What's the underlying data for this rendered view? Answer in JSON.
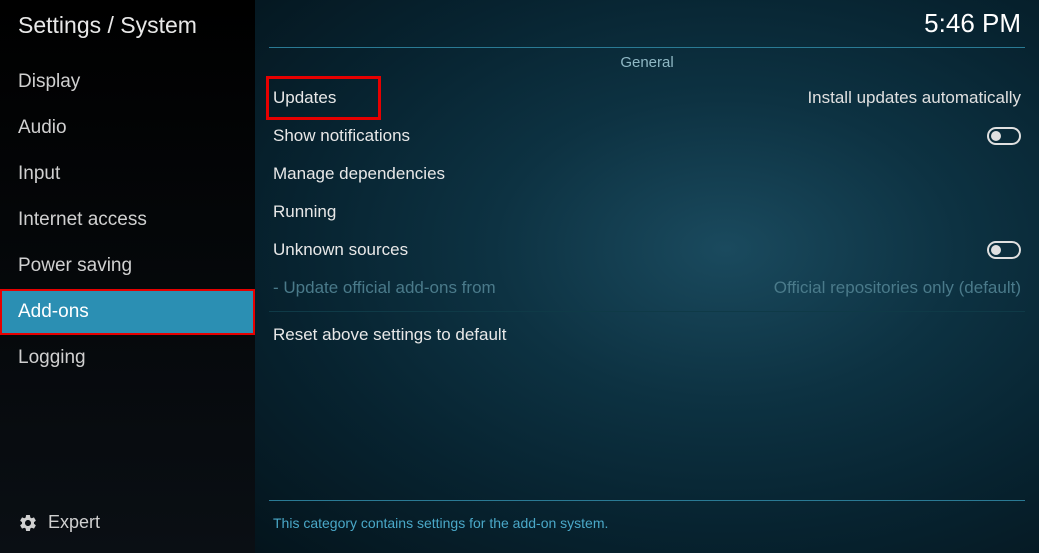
{
  "title": "Settings / System",
  "clock": "5:46 PM",
  "sidebar": {
    "items": [
      {
        "label": "Display"
      },
      {
        "label": "Audio"
      },
      {
        "label": "Input"
      },
      {
        "label": "Internet access"
      },
      {
        "label": "Power saving"
      },
      {
        "label": "Add-ons",
        "selected": true
      },
      {
        "label": "Logging"
      }
    ],
    "level": "Expert"
  },
  "main": {
    "section": "General",
    "settings": [
      {
        "label": "Updates",
        "value": "Install updates automatically",
        "highlighted": true
      },
      {
        "label": "Show notifications",
        "toggle": false
      },
      {
        "label": "Manage dependencies"
      },
      {
        "label": "Running"
      },
      {
        "label": "Unknown sources",
        "toggle": false
      },
      {
        "label": "- Update official add-ons from",
        "value": "Official repositories only (default)",
        "disabled": true
      }
    ],
    "reset": "Reset above settings to default",
    "description": "This category contains settings for the add-on system."
  }
}
